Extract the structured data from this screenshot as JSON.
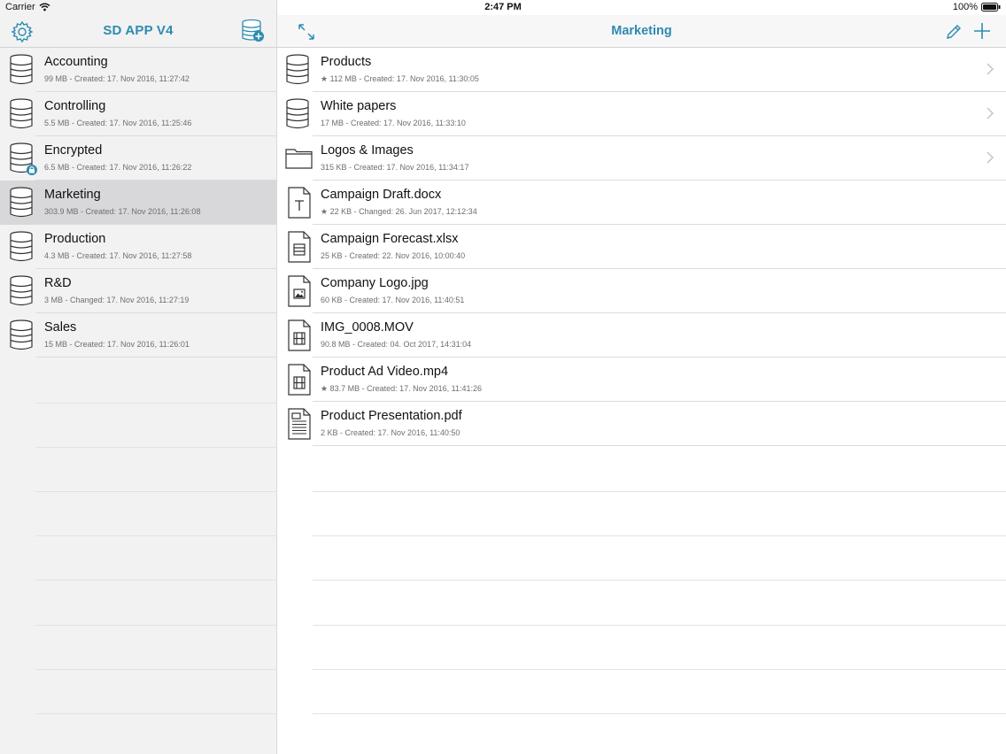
{
  "status": {
    "carrier": "Carrier",
    "time": "2:47 PM",
    "battery": "100%"
  },
  "sidebar": {
    "title": "SD APP V4",
    "items": [
      {
        "label": "Accounting",
        "sub": "99 MB - Created: 17. Nov 2016, 11:27:42"
      },
      {
        "label": "Controlling",
        "sub": "5.5 MB - Created: 17. Nov 2016, 11:25:46"
      },
      {
        "label": "Encrypted",
        "sub": "6.5 MB - Created: 17. Nov 2016, 11:26:22"
      },
      {
        "label": "Marketing",
        "sub": "303.9 MB - Created: 17. Nov 2016, 11:26:08"
      },
      {
        "label": "Production",
        "sub": "4.3 MB - Created: 17. Nov 2016, 11:27:58"
      },
      {
        "label": "R&D",
        "sub": "3 MB - Changed: 17. Nov 2016, 11:27:19"
      },
      {
        "label": "Sales",
        "sub": "15 MB - Created: 17. Nov 2016, 11:26:01"
      }
    ]
  },
  "main": {
    "title": "Marketing",
    "items": [
      {
        "label": "Products",
        "sub": "★ 112 MB - Created: 17. Nov 2016, 11:30:05",
        "icon": "database-icon"
      },
      {
        "label": "White papers",
        "sub": "17 MB - Created: 17. Nov 2016, 11:33:10",
        "icon": "database-icon"
      },
      {
        "label": "Logos & Images",
        "sub": "315 KB - Created: 17. Nov 2016, 11:34:17",
        "icon": "folder-icon"
      },
      {
        "label": "Campaign Draft.docx",
        "sub": "★ 22 KB - Changed: 26. Jun 2017, 12:12:34",
        "icon": "text-document-icon"
      },
      {
        "label": "Campaign Forecast.xlsx",
        "sub": "25 KB - Created: 22. Nov 2016, 10:00:40",
        "icon": "spreadsheet-document-icon"
      },
      {
        "label": "Company Logo.jpg",
        "sub": "60 KB - Created: 17. Nov 2016, 11:40:51",
        "icon": "image-document-icon"
      },
      {
        "label": "IMG_0008.MOV",
        "sub": "90.8 MB - Created: 04. Oct 2017, 14:31:04",
        "icon": "video-document-icon"
      },
      {
        "label": "Product Ad Video.mp4",
        "sub": "★ 83.7 MB - Created: 17. Nov 2016, 11:41:26",
        "icon": "video-document-icon"
      },
      {
        "label": "Product Presentation.pdf",
        "sub": "2 KB - Created: 17. Nov 2016, 11:40:50",
        "icon": "pdf-document-icon"
      }
    ]
  },
  "colors": {
    "accent": "#2d8bb0",
    "selected_row": "#d8d8da",
    "sidebar_bg": "#f2f2f3"
  }
}
